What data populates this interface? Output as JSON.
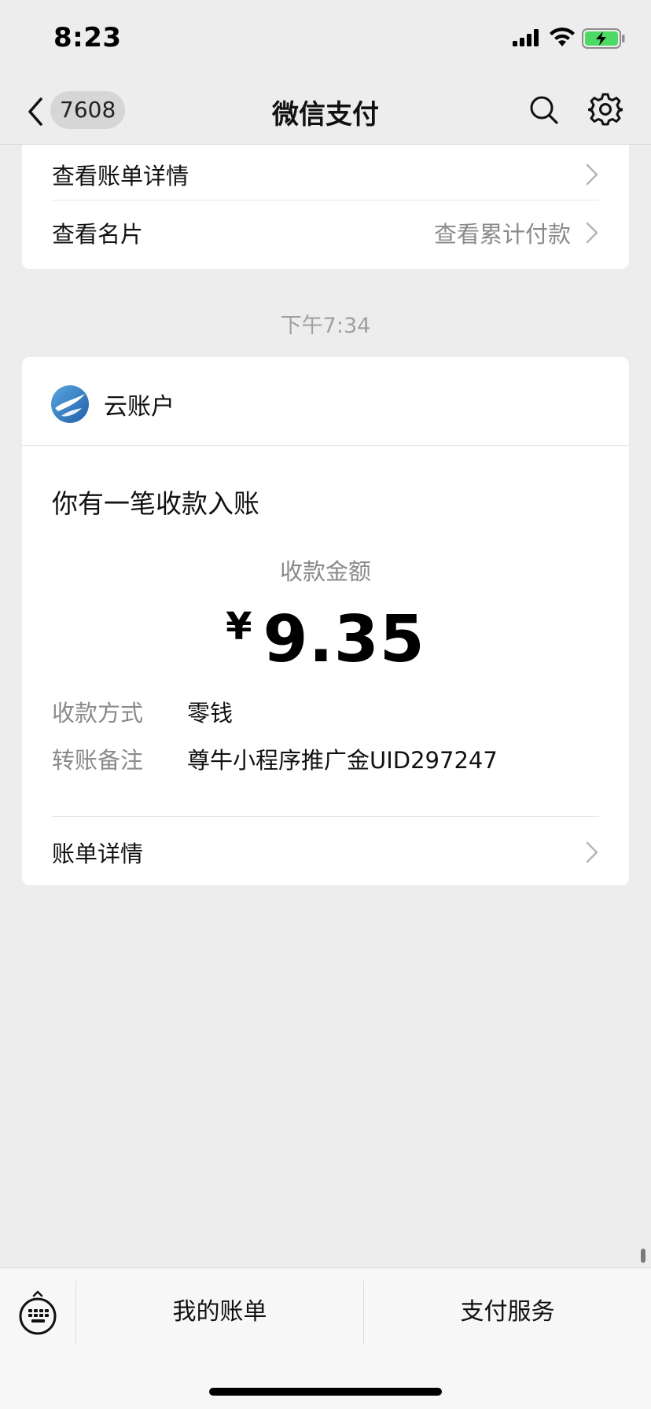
{
  "status_bar": {
    "time": "8:23"
  },
  "nav": {
    "badge": "7608",
    "title": "微信支付"
  },
  "top_card": {
    "rows": [
      {
        "label": "查看账单详情",
        "right": ""
      },
      {
        "label": "查看名片",
        "right": "查看累计付款"
      }
    ]
  },
  "timestamp": "下午7:34",
  "message": {
    "merchant": "云账户",
    "notice": "你有一笔收款入账",
    "amount_label": "收款金额",
    "currency_symbol": "¥",
    "amount": "9.35",
    "details": [
      {
        "key": "收款方式",
        "value": "零钱"
      },
      {
        "key": "转账备注",
        "value": "尊牛小程序推广金UID297247"
      }
    ],
    "bill_detail_label": "账单详情"
  },
  "bottom_menu": {
    "items": [
      "我的账单",
      "支付服务"
    ]
  },
  "colors": {
    "battery": "#4cd964",
    "background": "#ededed",
    "card": "#ffffff",
    "secondary_text": "#8a8a8a"
  },
  "icons": [
    "signal-icon",
    "wifi-icon",
    "battery-charging-icon",
    "chevron-left-icon",
    "search-icon",
    "gear-icon",
    "chevron-right-icon",
    "merchant-logo-icon",
    "keyboard-icon"
  ]
}
